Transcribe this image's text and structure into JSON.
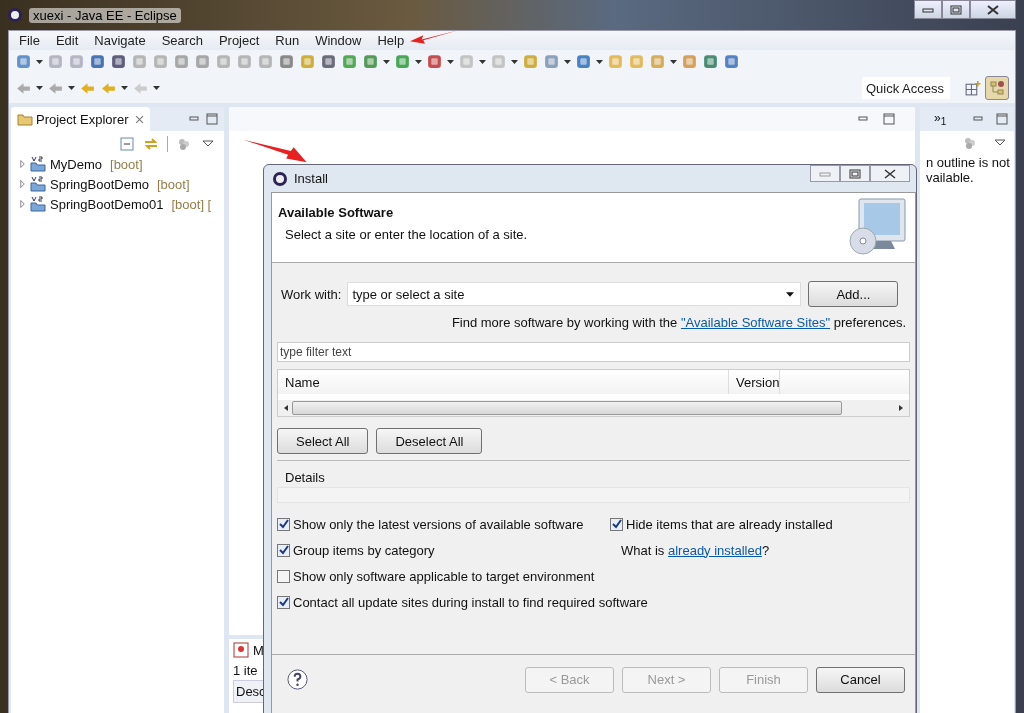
{
  "window": {
    "title": "xuexi - Java EE - Eclipse"
  },
  "menu": [
    "File",
    "Edit",
    "Navigate",
    "Search",
    "Project",
    "Run",
    "Window",
    "Help"
  ],
  "quick_access": {
    "placeholder": "Quick Access"
  },
  "project_explorer": {
    "title": "Project Explorer",
    "items": [
      {
        "name": "MyDemo",
        "tag": "[boot]",
        "expanded": false
      },
      {
        "name": "SpringBootDemo",
        "tag": "[boot]",
        "expanded": false
      },
      {
        "name": "SpringBootDemo01",
        "tag": "[boot] [",
        "expanded": false
      }
    ]
  },
  "outline": {
    "overflow_mark": "»",
    "overflow": "1",
    "lines": [
      "n outline is not",
      "vailable."
    ]
  },
  "bottom_panel": {
    "tab": "M",
    "status": "1 ite",
    "column": "Desc"
  },
  "dialog": {
    "title": "Install",
    "heading": "Available Software",
    "description": "Select a site or enter the location of a site.",
    "work_with": {
      "label": "Work with:",
      "value": "type or select a site"
    },
    "add_button": "Add...",
    "info": {
      "before": "Find more software by working with the",
      "link": "\"Available Software Sites\"",
      "after": "preferences."
    },
    "filter": {
      "placeholder": "type filter text"
    },
    "table": {
      "columns": [
        "Name",
        "Version"
      ]
    },
    "select_buttons": [
      "Select All",
      "Deselect All"
    ],
    "details_label": "Details",
    "options": [
      {
        "label": "Show only the latest versions of available software",
        "checked": true
      },
      {
        "label": "Hide items that are already installed",
        "checked": true
      },
      {
        "label": "Group items by category",
        "checked": true
      },
      {
        "kind": "link",
        "prefix": "What is",
        "link": "already installed",
        "suffix": "?"
      },
      {
        "label": "Show only software applicable to target environment",
        "checked": false
      },
      {
        "kind": "empty"
      },
      {
        "label": "Contact all update sites during install to find required software",
        "checked": true
      }
    ],
    "footer_buttons": [
      {
        "label": "< Back",
        "disabled": true
      },
      {
        "label": "Next >",
        "disabled": true
      },
      {
        "label": "Finish",
        "disabled": true
      },
      {
        "label": "Cancel",
        "disabled": false
      }
    ]
  }
}
